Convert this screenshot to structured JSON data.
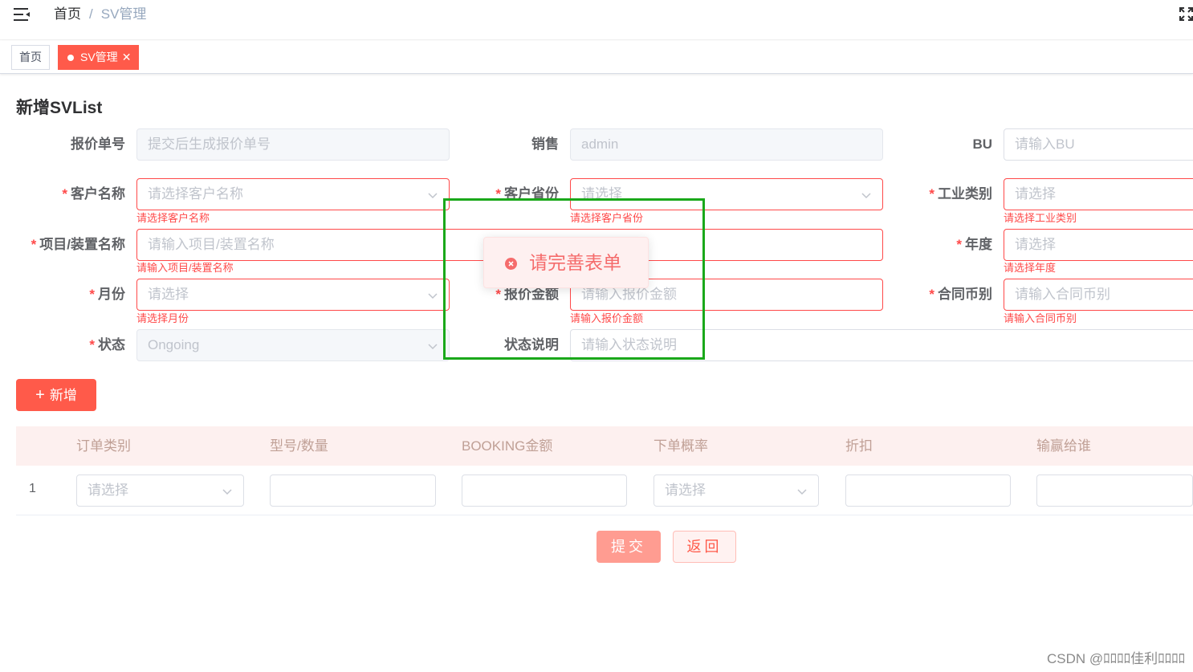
{
  "navbar": {
    "breadcrumb_home": "首页",
    "breadcrumb_sep": "/",
    "breadcrumb_current": "SV管理"
  },
  "tags": [
    {
      "label": "首页"
    },
    {
      "label": "SV管理",
      "close": "✕"
    }
  ],
  "form": {
    "title": "新增SVList",
    "fields": {
      "quote_no": {
        "label": "报价单号",
        "placeholder": "提交后生成报价单号"
      },
      "sales": {
        "label": "销售",
        "value": "admin"
      },
      "bu": {
        "label": "BU",
        "placeholder": "请输入BU"
      },
      "customer": {
        "label": "客户名称",
        "placeholder": "请选择客户名称",
        "error": "请选择客户名称"
      },
      "province": {
        "label": "客户省份",
        "placeholder": "请选择",
        "error": "请选择客户省份"
      },
      "industry": {
        "label": "工业类别",
        "placeholder": "请选择",
        "error": "请选择工业类别"
      },
      "project": {
        "label": "项目/装置名称",
        "placeholder": "请输入项目/装置名称",
        "error": "请输入项目/装置名称"
      },
      "year": {
        "label": "年度",
        "placeholder": "请选择",
        "error": "请选择年度"
      },
      "month": {
        "label": "月份",
        "placeholder": "请选择",
        "error": "请选择月份"
      },
      "amount": {
        "label": "报价金额",
        "placeholder": "请输入报价金额",
        "error": "请输入报价金额"
      },
      "currency": {
        "label": "合同币别",
        "placeholder": "请输入合同币别",
        "error": "请输入合同币别"
      },
      "status": {
        "label": "状态",
        "value": "Ongoing"
      },
      "status_desc": {
        "label": "状态说明",
        "placeholder": "请输入状态说明"
      }
    },
    "required_mark": "*"
  },
  "add_button": {
    "plus": "+",
    "label": "新增"
  },
  "table": {
    "headers": [
      "订单类别",
      "型号/数量",
      "BOOKING金额",
      "下单概率",
      "折扣",
      "输赢给谁"
    ],
    "rows": [
      {
        "index": "1",
        "order_type_placeholder": "请选择",
        "probability_placeholder": "请选择"
      }
    ]
  },
  "actions": {
    "submit": "提交",
    "back": "返回"
  },
  "toast": {
    "message": "请完善表单",
    "type": "error"
  },
  "watermark": "CSDN @ﾛﾛﾛﾛ佳利ﾛﾛﾛﾛ",
  "colors": {
    "accent": "#ff5a4a",
    "error": "#ff4949",
    "highlight": "#1aa81a"
  },
  "icons": [
    "hamburger-icon",
    "fullscreen-icon",
    "chevron-down-icon",
    "close-icon",
    "error-circle-icon",
    "plus-icon"
  ]
}
